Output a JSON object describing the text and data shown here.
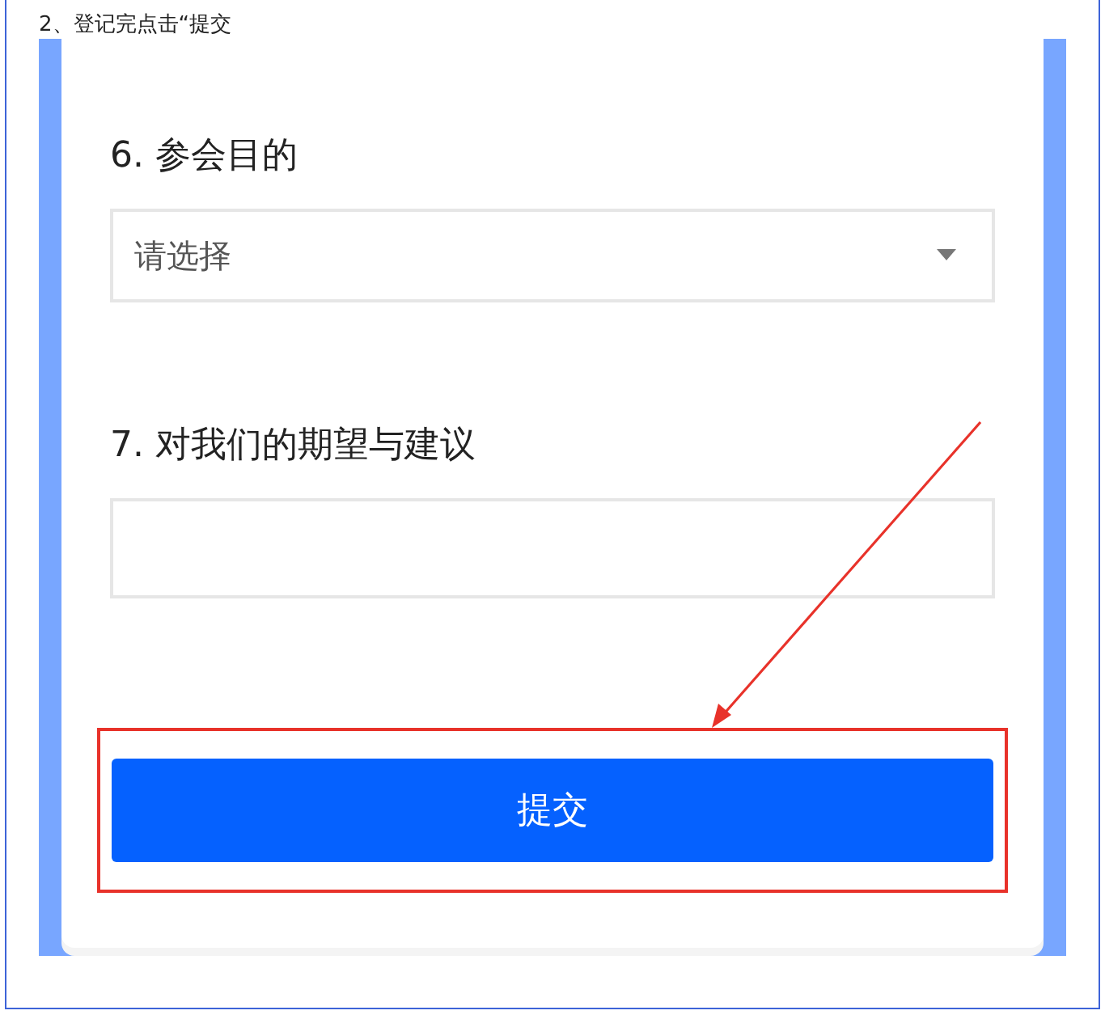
{
  "caption": "2、登记完点击“提交",
  "questions": [
    {
      "label": "6. 参会目的",
      "kind": "select",
      "placeholder": "请选择"
    },
    {
      "label": "7. 对我们的期望与建议",
      "kind": "textarea"
    }
  ],
  "submit_button": {
    "label": "提交",
    "highlighted": true
  }
}
